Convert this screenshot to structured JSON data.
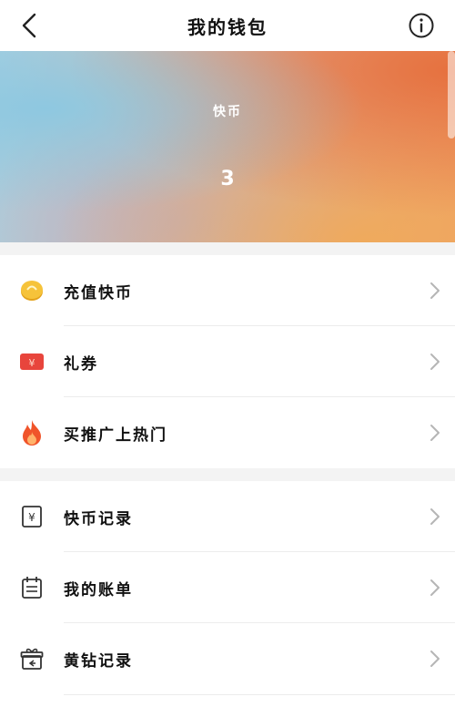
{
  "header": {
    "title": "我的钱包"
  },
  "balance": {
    "label": "快币",
    "value": "3"
  },
  "section1": {
    "items": [
      {
        "label": "充值快币",
        "icon": "gold-coin-icon"
      },
      {
        "label": "礼券",
        "icon": "coupon-icon"
      },
      {
        "label": "买推广上热门",
        "icon": "flame-icon"
      }
    ]
  },
  "section2": {
    "items": [
      {
        "label": "快币记录",
        "icon": "yuan-receipt-icon"
      },
      {
        "label": "我的账单",
        "icon": "calendar-bill-icon"
      },
      {
        "label": "黄钻记录",
        "icon": "gift-icon"
      }
    ]
  },
  "colors": {
    "coupon_red": "#e8453c",
    "flame_orange": "#f0542a",
    "coin_gold": "#f2b92b"
  }
}
